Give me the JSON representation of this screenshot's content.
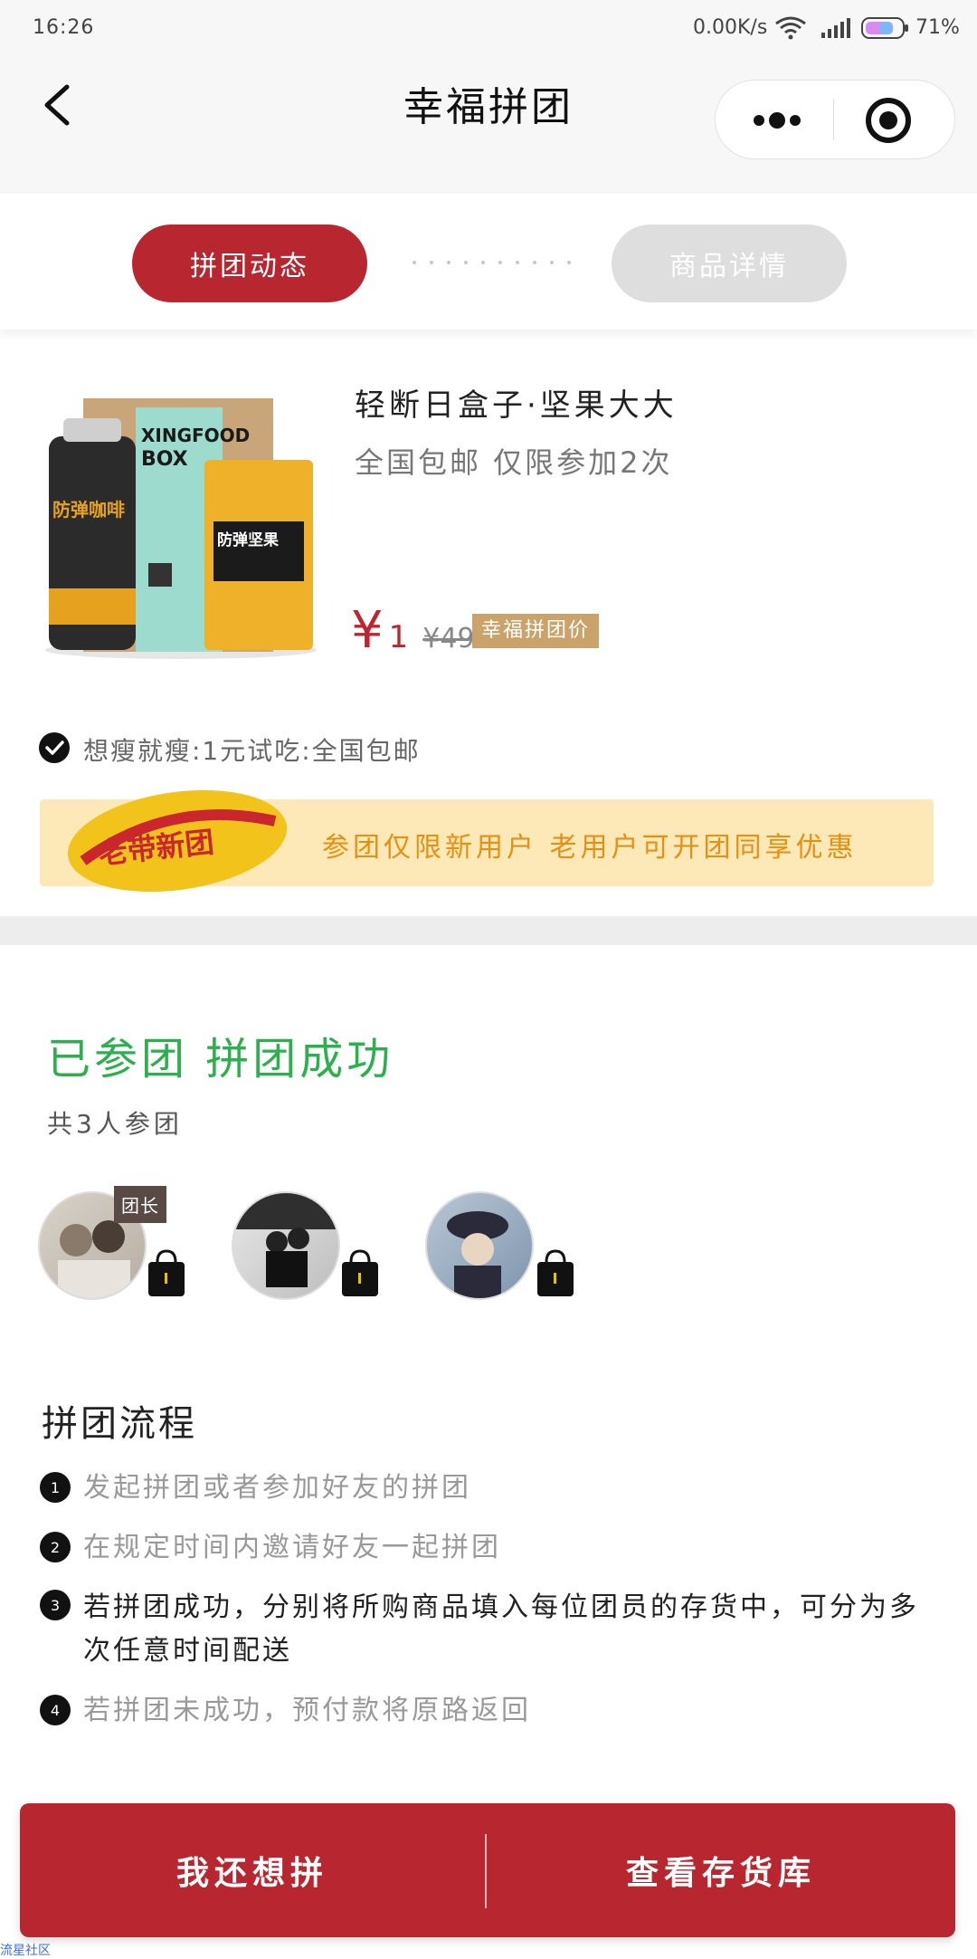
{
  "status_bar": {
    "time": "16:26",
    "speed": "0.00K/s",
    "battery": "71%"
  },
  "nav": {
    "title": "幸福拼团"
  },
  "tabs": [
    {
      "label": "拼团动态"
    },
    {
      "label": "商品详情"
    }
  ],
  "product": {
    "name": "轻断日盒子·坚果大大",
    "subtitle": "全国包邮  仅限参加2次",
    "price_symbol": "¥",
    "price": "1",
    "old_price": "¥49",
    "price_tag": "幸福拼团价",
    "box_text_1": "XINGFOOD",
    "box_text_2": "BOX",
    "can_text": "防弹咖啡",
    "bag_text": "防弹坚果"
  },
  "promo": {
    "text": "想瘦就瘦:1元试吃:全国包邮",
    "banner_logo": "老带新团",
    "banner_text": "参团仅限新用户  老用户可开团同享优惠"
  },
  "group": {
    "status": "已参团  拼团成功",
    "count": "共3人参团",
    "leader_badge": "团长"
  },
  "process": {
    "title": "拼团流程",
    "steps": [
      {
        "num": "1",
        "text": "发起拼团或者参加好友的拼团"
      },
      {
        "num": "2",
        "text": "在规定时间内邀请好友一起拼团"
      },
      {
        "num": "3",
        "text": "若拼团成功，分别将所购商品填入每位团员的存货中，可分为多次任意时间配送"
      },
      {
        "num": "4",
        "text": "若拼团未成功，预付款将原路返回"
      }
    ]
  },
  "bottom": {
    "btn_left": "我还想拼",
    "btn_right": "查看存货库",
    "footer": "流星社区"
  },
  "colors": {
    "brand_red": "#b8272f",
    "success_green": "#2bb04d",
    "banner_bg": "#fde9b8",
    "banner_text": "#e69012",
    "tag_gold": "#c9a36a"
  }
}
